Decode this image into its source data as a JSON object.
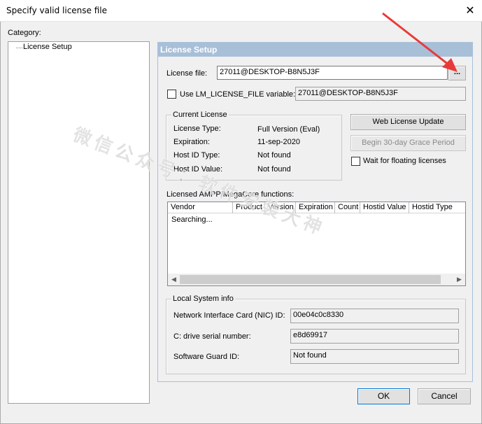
{
  "window": {
    "title": "Specify valid license file",
    "close_icon": "close-icon"
  },
  "category": {
    "label": "Category:",
    "items": [
      "License Setup"
    ]
  },
  "panel": {
    "header": "License Setup",
    "license_file_label": "License file:",
    "license_file_value": "27011@DESKTOP-B8N5J3F",
    "browse_label": "...",
    "use_lm_label": "Use LM_LICENSE_FILE variable:",
    "use_lm_checked": false,
    "use_lm_value": "27011@DESKTOP-B8N5J3F"
  },
  "current_license": {
    "title": "Current License",
    "rows": [
      {
        "label": "License Type:",
        "value": "Full Version (Eval)"
      },
      {
        "label": "Expiration:",
        "value": "11-sep-2020"
      },
      {
        "label": "Host ID Type:",
        "value": "Not found"
      },
      {
        "label": "Host ID Value:",
        "value": "Not found"
      }
    ]
  },
  "actions": {
    "web_update": "Web License Update",
    "grace_period": "Begin 30-day Grace Period",
    "grace_period_enabled": false,
    "wait_floating_label": "Wait for floating licenses",
    "wait_floating_checked": false
  },
  "functions": {
    "label": "Licensed AMPP/MegaCore functions:",
    "columns": [
      "Vendor",
      "Product",
      "Version",
      "Expiration",
      "Count",
      "Hostid Value",
      "Hostid Type"
    ],
    "rows": [
      "Searching..."
    ]
  },
  "local_system": {
    "title": "Local System info",
    "nic_label": "Network Interface Card (NIC) ID:",
    "nic_value": "00e04c0c8330",
    "drive_label": "C: drive serial number:",
    "drive_value": "e8d69917",
    "guard_label": "Software Guard ID:",
    "guard_value": "Not found"
  },
  "footer": {
    "ok": "OK",
    "cancel": "Cancel"
  },
  "overlay": {
    "watermark": "微信公众号：软件安装大神",
    "arrow_color": "#e83a3a"
  }
}
